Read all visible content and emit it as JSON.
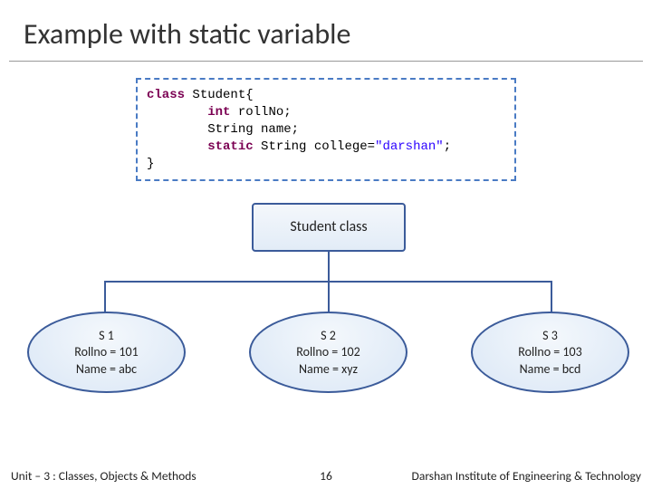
{
  "title": "Example with static variable",
  "code": {
    "l1_kw": "class",
    "l1_rest": " Student{",
    "l2_kw": "int",
    "l2_rest": " rollNo;",
    "l3": "        String name;",
    "l4_kw": "static",
    "l4_mid": " String college=",
    "l4_str": "\"darshan\"",
    "l4_end": ";",
    "l5": "}"
  },
  "diagram": {
    "class_label": "Student class",
    "s1": {
      "name": "S 1",
      "roll": "Rollno = 101",
      "nm": "Name = abc"
    },
    "s2": {
      "name": "S 2",
      "roll": "Rollno = 102",
      "nm": "Name = xyz"
    },
    "s3": {
      "name": "S 3",
      "roll": "Rollno = 103",
      "nm": "Name = bcd"
    }
  },
  "footer": {
    "left": "Unit – 3  : Classes, Objects & Methods",
    "mid": "16",
    "right": "Darshan Institute of Engineering & Technology"
  }
}
